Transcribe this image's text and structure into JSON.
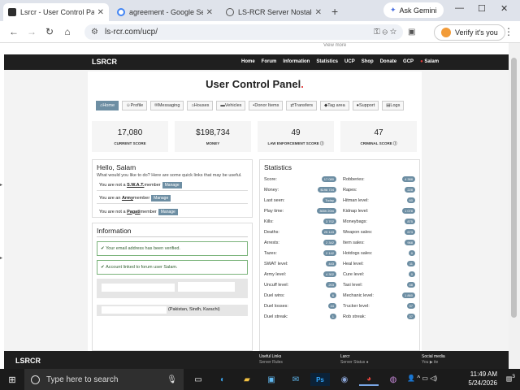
{
  "browser": {
    "tabs": [
      {
        "title": "Lsrcr - User Control Panel",
        "active": true,
        "color": "#2e2e2e"
      },
      {
        "title": "agreement - Google Search",
        "active": false,
        "color": "#4285f4"
      },
      {
        "title": "LS-RCR Server Nostalgia",
        "active": false,
        "color": "#555555"
      }
    ],
    "new_tab": "+",
    "gemini": "Ask Gemini",
    "url": "ls-rcr.com/ucp/",
    "verify": "Verify it's you",
    "minimize": "—",
    "maximize": "☐",
    "close": "✕"
  },
  "site": {
    "brand": "LSRCR",
    "top_note": "View more",
    "nav": [
      "Home",
      "Forum",
      "Information",
      "Statistics",
      "UCP",
      "Shop",
      "Donate",
      "GCP"
    ],
    "user": "Salam",
    "title": "User Control Panel",
    "title_dot": ".",
    "tabs": [
      "Home",
      "Profile",
      "Messaging",
      "Houses",
      "Vehicles",
      "Donor Items",
      "Transfers",
      "Tag area",
      "Support",
      "Logs"
    ],
    "stats": [
      {
        "value": "17,080",
        "label": "CURRENT SCORE"
      },
      {
        "value": "$198,734",
        "label": "MONEY"
      },
      {
        "value": "49",
        "label": "LAW ENFORCEMENT SCORE ⓘ"
      },
      {
        "value": "47",
        "label": "CRIMINAL SCORE ⓘ"
      }
    ],
    "hello": {
      "title": "Hello, Salam",
      "subtitle": "What would you like to do? Here are some quick links that may be useful.",
      "rows": [
        {
          "pre": "You are not a ",
          "name": "S.W.A.T.",
          "post": " member",
          "btn": "Manage"
        },
        {
          "pre": "You are an ",
          "name": "Army",
          "post": " member",
          "btn": "Manage"
        },
        {
          "pre": "You are not a ",
          "name": "Pagati",
          "post": " member",
          "btn": "Manage"
        }
      ]
    },
    "info": {
      "title": "Information",
      "alerts": [
        "Your email address has been verified.",
        "Account linked to forum user Salam."
      ],
      "location": "(Pakistan, Sindh, Karachi)"
    },
    "statistics": {
      "title": "Statistics",
      "left": [
        {
          "k": "Score:",
          "v": "17 080"
        },
        {
          "k": "Money:",
          "v": "$198 734"
        },
        {
          "k": "Last seen:",
          "v": "Today"
        },
        {
          "k": "Play time:",
          "v": "365h 20m"
        },
        {
          "k": "Kills:",
          "v": "3 702"
        },
        {
          "k": "Deaths:",
          "v": "25 143"
        },
        {
          "k": "Arrests:",
          "v": "2 342"
        },
        {
          "k": "Tazes:",
          "v": "2 142"
        },
        {
          "k": "SWAT level:",
          "v": "443"
        },
        {
          "k": "Army level:",
          "v": "4 302"
        },
        {
          "k": "Uncuff level:",
          "v": "203"
        },
        {
          "k": "Duel wins:",
          "v": "6"
        },
        {
          "k": "Duel losses:",
          "v": "44"
        },
        {
          "k": "Duel streak:",
          "v": "1"
        }
      ],
      "right": [
        {
          "k": "Robberies:",
          "v": "4 388"
        },
        {
          "k": "Rapes:",
          "v": "228"
        },
        {
          "k": "Hitman level:",
          "v": "60"
        },
        {
          "k": "Kidnap level:",
          "v": "1 078"
        },
        {
          "k": "Moneybags:",
          "v": "875"
        },
        {
          "k": "Weapon sales:",
          "v": "673"
        },
        {
          "k": "Item sales:",
          "v": "968"
        },
        {
          "k": "Hotdogs sales:",
          "v": "0"
        },
        {
          "k": "Heal level:",
          "v": "11"
        },
        {
          "k": "Cure level:",
          "v": "0"
        },
        {
          "k": "Taxi level:",
          "v": "48"
        },
        {
          "k": "Mechanic level:",
          "v": "1 860"
        },
        {
          "k": "Trucker level:",
          "v": "37"
        },
        {
          "k": "Rob streak:",
          "v": "37"
        }
      ]
    },
    "footer": {
      "brand": "LSRCR",
      "col1": "Useful Links",
      "col1_sub": "Server Rules",
      "col2": "Larcr",
      "col2_sub": "Server Status ●",
      "col3": "Social media",
      "col3_sub": "You ▶ ite"
    }
  },
  "taskbar": {
    "search_placeholder": "Type here to search",
    "time": "11:49 AM",
    "date": "5/24/2026",
    "notif": "3"
  }
}
